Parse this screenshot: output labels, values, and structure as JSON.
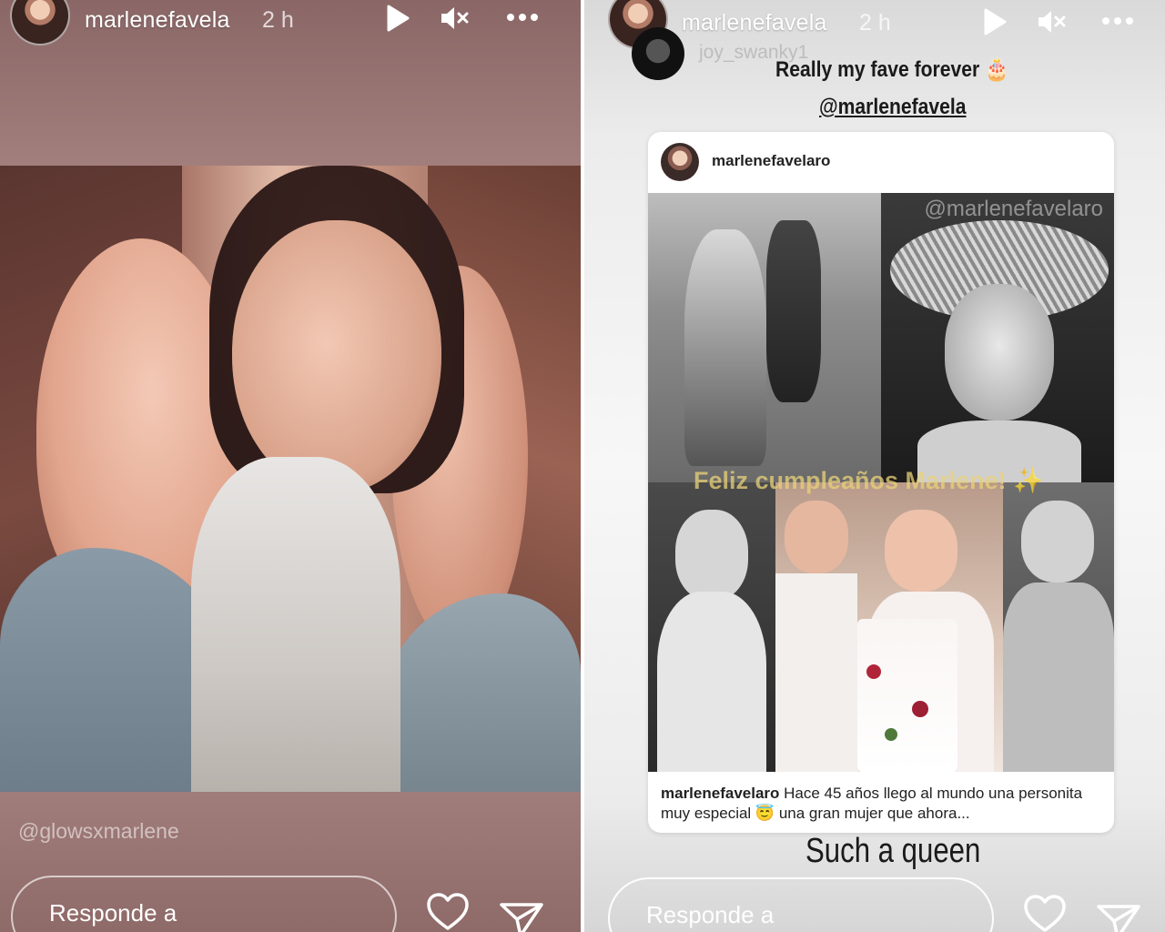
{
  "left_story": {
    "username": "marlenefavela",
    "time": "2 h",
    "mention": "@glowsxmarlene",
    "reply_placeholder": "Responde a"
  },
  "right_story": {
    "username": "marlenefavela",
    "time": "2 h",
    "reposter": "joy_swanky1",
    "sticker_line1": "Really my fave forever 🎂",
    "sticker_line2": "@marlenefavela",
    "card_user": "marlenefavelaro",
    "watermark": "@marlenefavelaro",
    "collage_text": "Feliz cumpleaños Marlene! ✨",
    "caption_user": "marlenefavelaro",
    "caption_text": " Hace 45 años llego al mundo una personita muy especial 😇 una gran mujer que ahora...",
    "footer_text": "Such a queen",
    "reply_placeholder": "Responde a"
  },
  "icons": [
    "play-icon",
    "mute-icon",
    "more-icon",
    "heart-icon",
    "send-icon"
  ],
  "colors": {
    "left_bg": "#a88583",
    "right_bg": "#f2f2f2",
    "text_light": "#ffffff",
    "text_dark": "#1a1a1a"
  }
}
